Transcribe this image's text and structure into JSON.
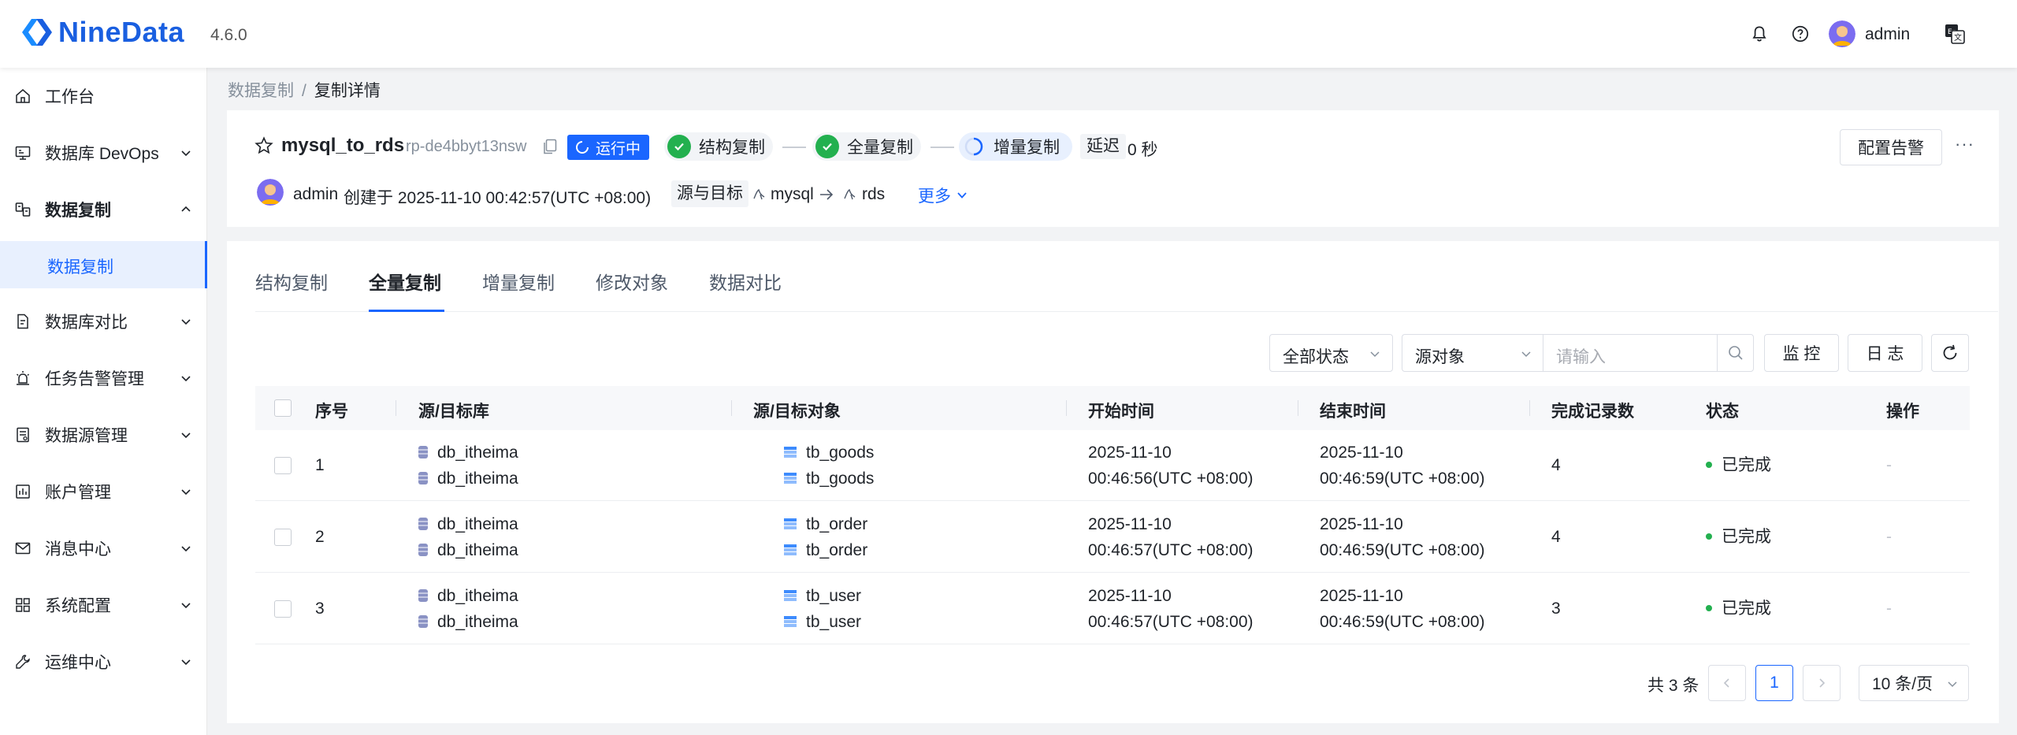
{
  "app": {
    "name": "NineData",
    "version": "4.6.0",
    "user": "admin"
  },
  "sidebar": {
    "items": [
      {
        "label": "工作台",
        "icon": "home-icon"
      },
      {
        "label": "数据库 DevOps",
        "icon": "monitor-icon"
      },
      {
        "label": "数据复制",
        "icon": "replicate-icon"
      },
      {
        "label": "数据库对比",
        "icon": "compare-icon"
      },
      {
        "label": "任务告警管理",
        "icon": "alarm-icon"
      },
      {
        "label": "数据源管理",
        "icon": "datasource-icon"
      },
      {
        "label": "账户管理",
        "icon": "account-icon"
      },
      {
        "label": "消息中心",
        "icon": "mail-icon"
      },
      {
        "label": "系统配置",
        "icon": "grid-icon"
      },
      {
        "label": "运维中心",
        "icon": "wrench-icon"
      }
    ],
    "sub_item": "数据复制"
  },
  "breadcrumb": {
    "parent": "数据复制",
    "separator": "/",
    "current": "复制详情"
  },
  "task": {
    "name": "mysql_to_rds",
    "id": "rp-de4bbyt13nsw",
    "status": "运行中",
    "stages": [
      "结构复制",
      "全量复制",
      "增量复制"
    ],
    "delay_label": "延迟",
    "delay_value": "0 秒",
    "creator": "admin",
    "created_text": "创建于 2025-11-10 00:42:57(UTC +08:00)",
    "src_dst_label": "源与目标",
    "source": "mysql",
    "target": "rds",
    "more": "更多",
    "alarm_button": "配置告警",
    "more_dots": "···"
  },
  "tabs": [
    "结构复制",
    "全量复制",
    "增量复制",
    "修改对象",
    "数据对比"
  ],
  "filters": {
    "status": "全部状态",
    "object": "源对象",
    "search_placeholder": "请输入",
    "monitor_button": "监 控",
    "log_button": "日 志"
  },
  "table": {
    "columns": [
      "序号",
      "源/目标库",
      "源/目标对象",
      "开始时间",
      "结束时间",
      "完成记录数",
      "状态",
      "操作"
    ],
    "rows": [
      {
        "index": "1",
        "src_db": "db_itheima",
        "dst_db": "db_itheima",
        "src_obj": "tb_goods",
        "dst_obj": "tb_goods",
        "start_date": "2025-11-10",
        "start_time": "00:46:56(UTC +08:00)",
        "end_date": "2025-11-10",
        "end_time": "00:46:59(UTC +08:00)",
        "count": "4",
        "status": "已完成",
        "action": "-"
      },
      {
        "index": "2",
        "src_db": "db_itheima",
        "dst_db": "db_itheima",
        "src_obj": "tb_order",
        "dst_obj": "tb_order",
        "start_date": "2025-11-10",
        "start_time": "00:46:57(UTC +08:00)",
        "end_date": "2025-11-10",
        "end_time": "00:46:59(UTC +08:00)",
        "count": "4",
        "status": "已完成",
        "action": "-"
      },
      {
        "index": "3",
        "src_db": "db_itheima",
        "dst_db": "db_itheima",
        "src_obj": "tb_user",
        "dst_obj": "tb_user",
        "start_date": "2025-11-10",
        "start_time": "00:46:57(UTC +08:00)",
        "end_date": "2025-11-10",
        "end_time": "00:46:59(UTC +08:00)",
        "count": "3",
        "status": "已完成",
        "action": "-"
      }
    ]
  },
  "pagination": {
    "total": "共 3 条",
    "current_page": "1",
    "page_size": "10 条/页"
  },
  "colors": {
    "primary": "#1a66ff",
    "success": "#23b04f",
    "running": "#1a66ff"
  }
}
